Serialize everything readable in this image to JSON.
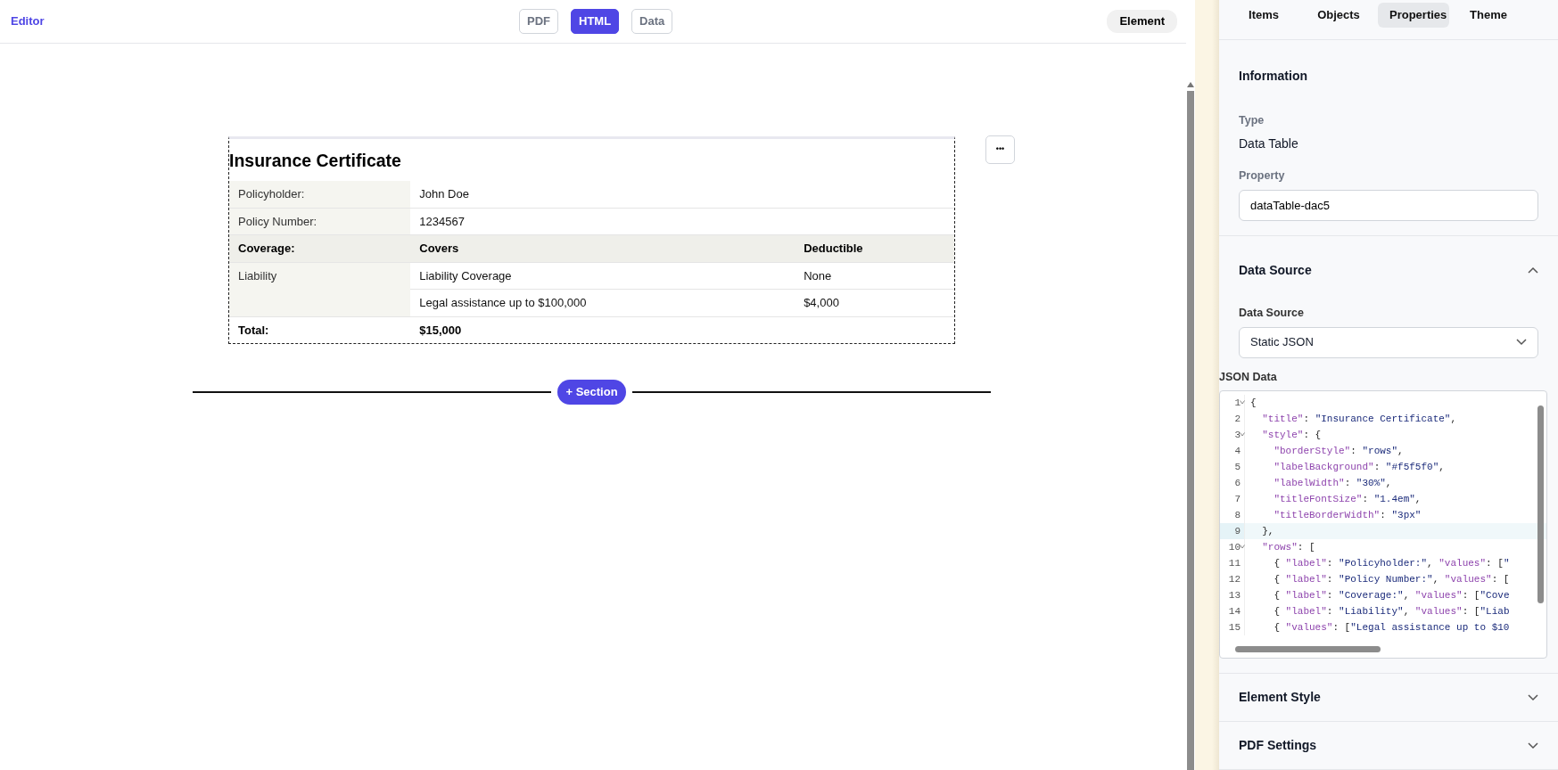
{
  "topbar": {
    "brand": "Editor",
    "modes": [
      {
        "label": "PDF",
        "selected": false
      },
      {
        "label": "HTML",
        "selected": true
      },
      {
        "label": "Data",
        "selected": false
      }
    ],
    "element_button": "Element"
  },
  "document": {
    "title": "Insurance Certificate",
    "rows": [
      {
        "kind": "field",
        "label": "Policyholder:",
        "cells": [
          "John Doe"
        ]
      },
      {
        "kind": "field",
        "label": "Policy Number:",
        "cells": [
          "1234567"
        ]
      },
      {
        "kind": "header",
        "label": "Coverage:",
        "cells": [
          "Covers",
          "Deductible"
        ]
      },
      {
        "kind": "field",
        "label": "Liability",
        "cells": [
          "Liability Coverage",
          "None"
        ]
      },
      {
        "kind": "field",
        "cells": [
          "Legal assistance up to $100,000",
          "$4,000"
        ]
      },
      {
        "kind": "total",
        "label": "Total:",
        "cells": [
          "$15,000"
        ]
      }
    ],
    "menu_button": "•••",
    "add_section": "+ Section"
  },
  "panel": {
    "tabs": [
      {
        "label": "Items",
        "selected": false
      },
      {
        "label": "Objects",
        "selected": false
      },
      {
        "label": "Properties",
        "selected": true
      },
      {
        "label": "Theme",
        "selected": false
      }
    ],
    "information": {
      "heading": "Information",
      "type_label": "Type",
      "type_value": "Data Table",
      "property_label": "Property",
      "property_value": "dataTable-dac5"
    },
    "data_source": {
      "heading": "Data Source",
      "expanded": true,
      "field_label": "Data Source",
      "select_value": "Static JSON",
      "json_label": "JSON Data",
      "code_lines": [
        {
          "number": "1",
          "text": "{",
          "foldable": true,
          "highlighted": false
        },
        {
          "number": "2",
          "text": "  \"title\": \"Insurance Certificate\",",
          "foldable": false,
          "highlighted": false
        },
        {
          "number": "3",
          "text": "  \"style\": {",
          "foldable": true,
          "highlighted": false
        },
        {
          "number": "4",
          "text": "    \"borderStyle\": \"rows\",",
          "foldable": false,
          "highlighted": false
        },
        {
          "number": "5",
          "text": "    \"labelBackground\": \"#f5f5f0\",",
          "foldable": false,
          "highlighted": false
        },
        {
          "number": "6",
          "text": "    \"labelWidth\": \"30%\",",
          "foldable": false,
          "highlighted": false
        },
        {
          "number": "7",
          "text": "    \"titleFontSize\": \"1.4em\",",
          "foldable": false,
          "highlighted": false
        },
        {
          "number": "8",
          "text": "    \"titleBorderWidth\": \"3px\"",
          "foldable": false,
          "highlighted": false
        },
        {
          "number": "9",
          "text": "  },",
          "foldable": false,
          "highlighted": true
        },
        {
          "number": "10",
          "text": "  \"rows\": [",
          "foldable": true,
          "highlighted": false
        },
        {
          "number": "11",
          "text": "    { \"label\": \"Policyholder:\", \"values\": [\"",
          "foldable": false,
          "highlighted": false
        },
        {
          "number": "12",
          "text": "    { \"label\": \"Policy Number:\", \"values\": [",
          "foldable": false,
          "highlighted": false
        },
        {
          "number": "13",
          "text": "    { \"label\": \"Coverage:\", \"values\": [\"Cove",
          "foldable": false,
          "highlighted": false
        },
        {
          "number": "14",
          "text": "    { \"label\": \"Liability\", \"values\": [\"Liab",
          "foldable": false,
          "highlighted": false
        },
        {
          "number": "15",
          "text": "    { \"values\": [\"Legal assistance up to $10",
          "foldable": false,
          "highlighted": false
        }
      ]
    },
    "sections": [
      {
        "heading": "Element Style",
        "expanded": false
      },
      {
        "heading": "PDF Settings",
        "expanded": false
      }
    ]
  }
}
